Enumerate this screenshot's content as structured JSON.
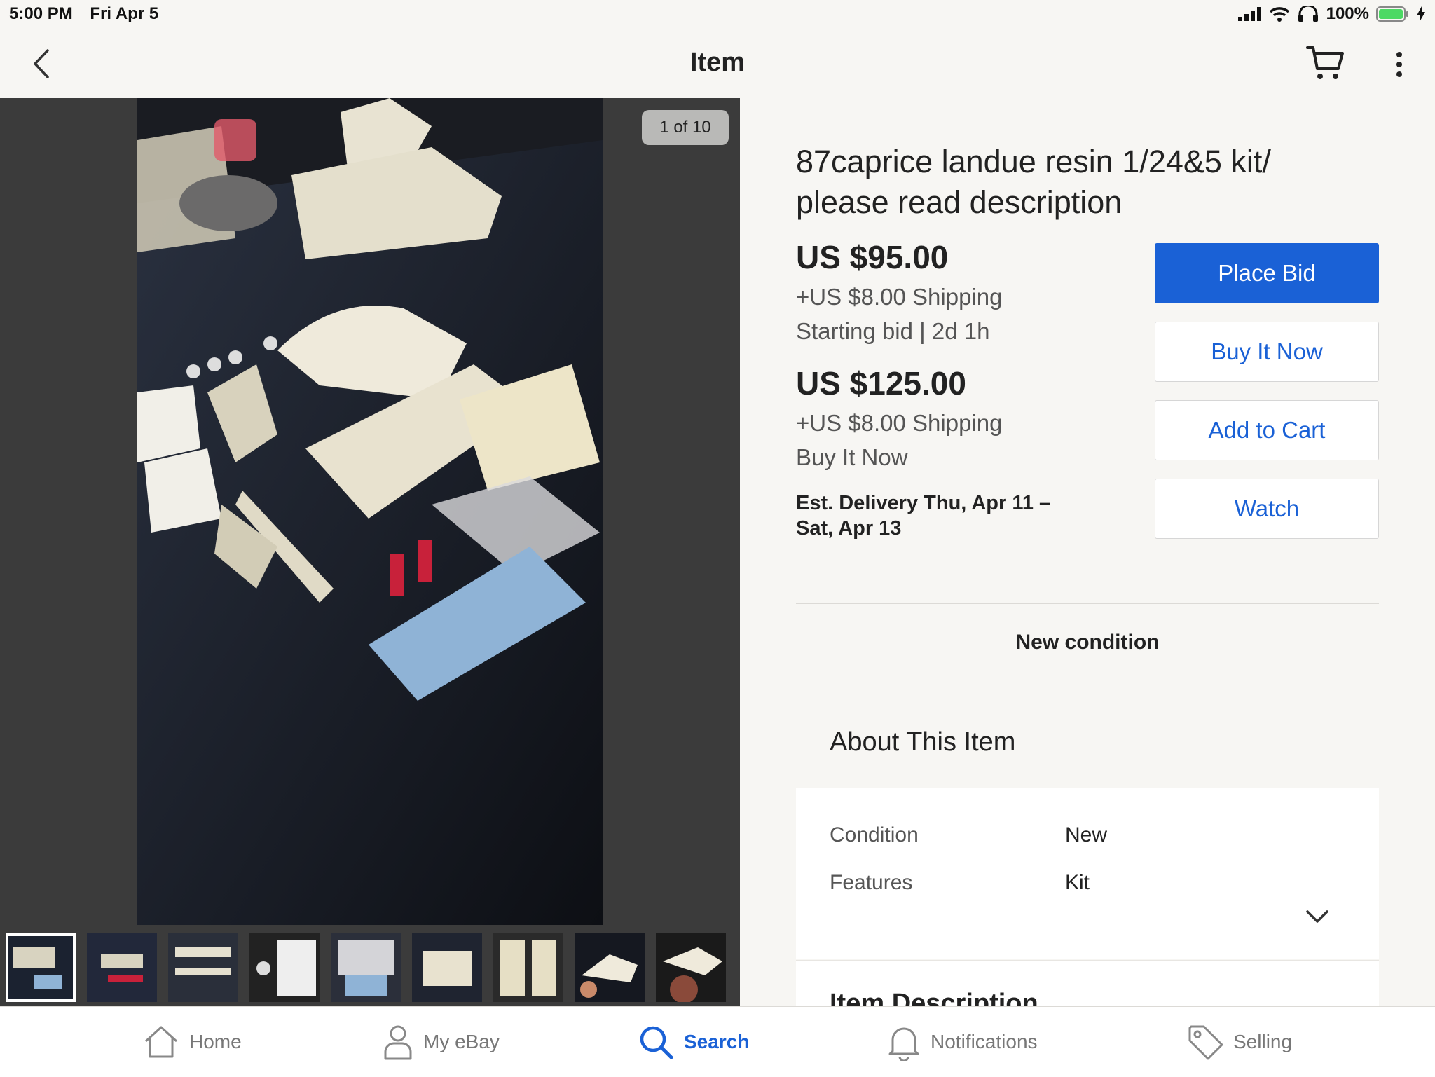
{
  "status_bar": {
    "time": "5:00 PM",
    "date": "Fri Apr 5",
    "battery": "100%",
    "battery_level": 1.0
  },
  "nav": {
    "title": "Item",
    "back_icon": "chevron-left-icon",
    "cart_icon": "cart-icon",
    "more_icon": "more-vertical-icon"
  },
  "gallery": {
    "counter": "1 of 10",
    "thumbnail_count": 9,
    "active_thumbnail": 1
  },
  "item": {
    "title": "87caprice landue resin 1/24&5 kit/ please read description",
    "bid_price": "US $95.00",
    "bid_shipping": "+US $8.00 Shipping",
    "bid_info": "Starting bid | 2d 1h",
    "bin_price": "US $125.00",
    "bin_shipping": "+US $8.00 Shipping",
    "bin_info": "Buy It Now",
    "delivery": "Est. Delivery Thu, Apr 11 – Sat, Apr 13"
  },
  "actions": {
    "place_bid": "Place Bid",
    "buy_it_now": "Buy It Now",
    "add_to_cart": "Add to Cart",
    "watch": "Watch"
  },
  "condition_note": "New condition",
  "about": {
    "heading": "About This Item",
    "specs": [
      {
        "label": "Condition",
        "value": "New"
      },
      {
        "label": "Features",
        "value": "Kit"
      }
    ]
  },
  "description": {
    "heading": "Item Description"
  },
  "tabs": [
    {
      "label": "Home",
      "icon": "home-icon"
    },
    {
      "label": "My eBay",
      "icon": "user-icon"
    },
    {
      "label": "Search",
      "icon": "search-icon"
    },
    {
      "label": "Notifications",
      "icon": "bell-icon"
    },
    {
      "label": "Selling",
      "icon": "tag-icon"
    }
  ],
  "colors": {
    "accent": "#1a61d6",
    "background": "#f7f6f3",
    "gallery_bg": "#3b3b3b"
  }
}
